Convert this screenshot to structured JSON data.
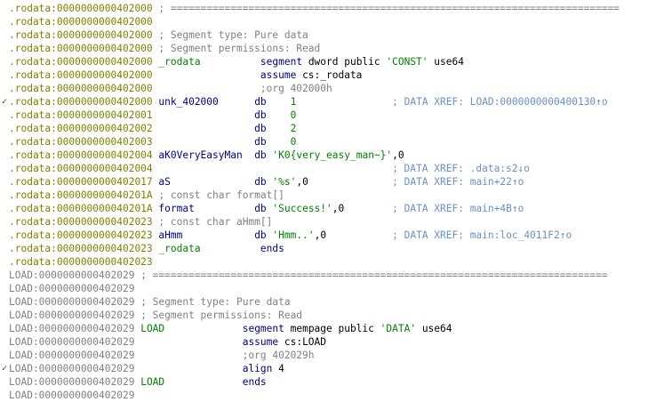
{
  "rows": [
    {
      "addr": ".rodata:0000000000402000",
      "seg": "rodata",
      "text": " ; ==========================================================================="
    },
    {
      "addr": ".rodata:0000000000402000",
      "seg": "rodata",
      "text": ""
    },
    {
      "addr": ".rodata:0000000000402000",
      "seg": "rodata",
      "text": " ; Segment type: Pure data"
    },
    {
      "addr": ".rodata:0000000000402000",
      "seg": "rodata",
      "text": " ; Segment permissions: Read"
    },
    {
      "addr": ".rodata:0000000000402000",
      "seg": "rodata",
      "text": " _rodata          segment dword public 'CONST' use64"
    },
    {
      "addr": ".rodata:0000000000402000",
      "seg": "rodata",
      "text": "                  assume cs:_rodata"
    },
    {
      "addr": ".rodata:0000000000402000",
      "seg": "rodata",
      "text": "                  ;org 402000h"
    },
    {
      "addr": ".rodata:0000000000402000",
      "seg": "rodata",
      "text": " unk_402000      db    1                ; DATA XREF: LOAD:0000000000400130↑o",
      "mark": "✓"
    },
    {
      "addr": ".rodata:0000000000402001",
      "seg": "rodata",
      "text": "                 db    0"
    },
    {
      "addr": ".rodata:0000000000402002",
      "seg": "rodata",
      "text": "                 db    2"
    },
    {
      "addr": ".rodata:0000000000402003",
      "seg": "rodata",
      "text": "                 db    0"
    },
    {
      "addr": ".rodata:0000000000402004",
      "seg": "rodata",
      "text": " aK0VeryEasyMan  db 'K0{very_easy_man~}',0"
    },
    {
      "addr": ".rodata:0000000000402004",
      "seg": "rodata",
      "text": "                                        ; DATA XREF: .data:s2↓o"
    },
    {
      "addr": ".rodata:0000000000402017",
      "seg": "rodata",
      "text": " aS              db '%s',0              ; DATA XREF: main+22↑o"
    },
    {
      "addr": ".rodata:000000000040201A",
      "seg": "rodata",
      "text": " ; const char format[]"
    },
    {
      "addr": ".rodata:000000000040201A",
      "seg": "rodata",
      "text": " format          db 'Success!',0        ; DATA XREF: main+4B↑o"
    },
    {
      "addr": ".rodata:0000000000402023",
      "seg": "rodata",
      "text": " ; const char aHmm[]"
    },
    {
      "addr": ".rodata:0000000000402023",
      "seg": "rodata",
      "text": " aHmm            db 'Hmm..',0           ; DATA XREF: main:loc_4011F2↑o"
    },
    {
      "addr": ".rodata:0000000000402023",
      "seg": "rodata",
      "text": " _rodata          ends"
    },
    {
      "addr": ".rodata:0000000000402023",
      "seg": "rodata",
      "text": ""
    },
    {
      "addr": "LOAD:0000000000402029",
      "seg": "load",
      "text": " ; ============================================================================"
    },
    {
      "addr": "LOAD:0000000000402029",
      "seg": "load",
      "text": ""
    },
    {
      "addr": "LOAD:0000000000402029",
      "seg": "load",
      "text": " ; Segment type: Pure data"
    },
    {
      "addr": "LOAD:0000000000402029",
      "seg": "load",
      "text": " ; Segment permissions: Read"
    },
    {
      "addr": "LOAD:0000000000402029",
      "seg": "load",
      "text": " LOAD             segment mempage public 'DATA' use64"
    },
    {
      "addr": "LOAD:0000000000402029",
      "seg": "load",
      "text": "                  assume cs:LOAD"
    },
    {
      "addr": "LOAD:0000000000402029",
      "seg": "load",
      "text": "                  ;org 402029h"
    },
    {
      "addr": "LOAD:0000000000402029",
      "seg": "load",
      "text": "                  align 4",
      "mark": "✓"
    },
    {
      "addr": "LOAD:0000000000402029",
      "seg": "load",
      "text": " LOAD             ends"
    },
    {
      "addr": "LOAD:0000000000402029",
      "seg": "load",
      "text": ""
    }
  ]
}
